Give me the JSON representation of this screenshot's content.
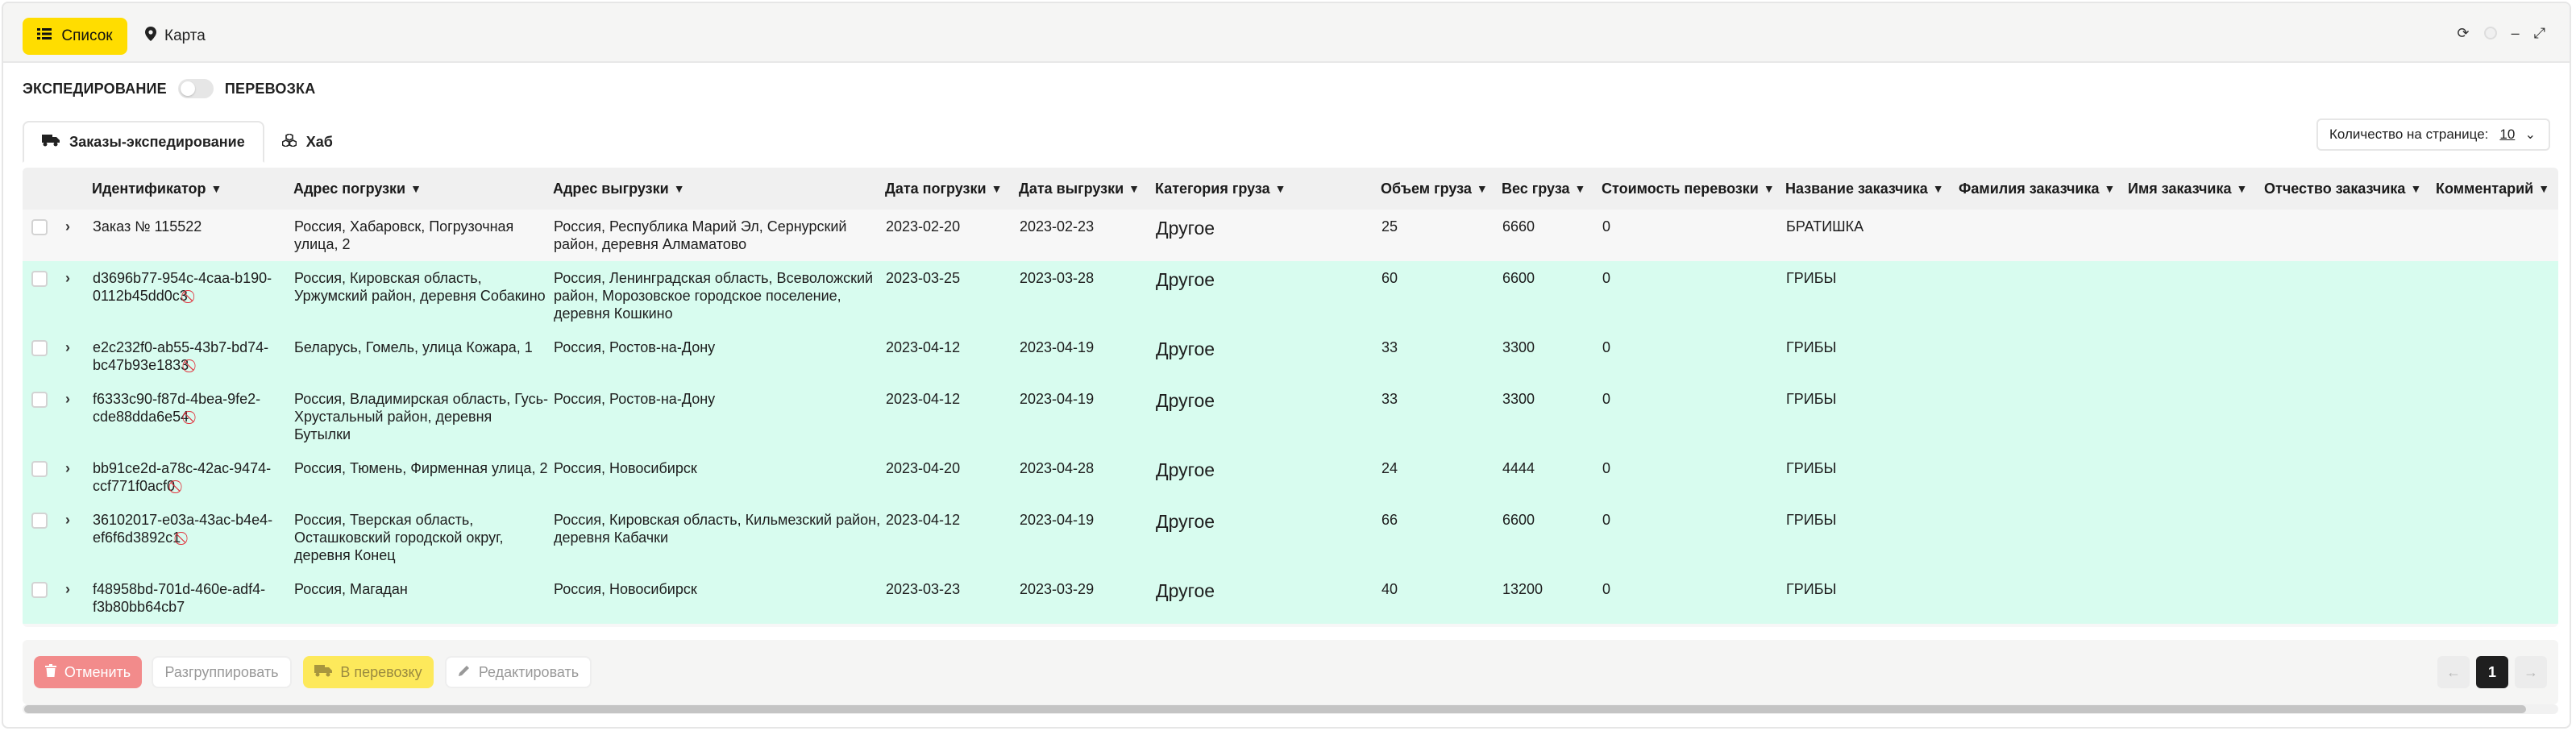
{
  "toolbar": {
    "list_label": "Список",
    "map_label": "Карта"
  },
  "mode_toggle": {
    "left_label": "ЭКСПЕДИРОВАНИЕ",
    "right_label": "ПЕРЕВОЗКА"
  },
  "tabs": [
    {
      "label": "Заказы-экспедирование",
      "active": true
    },
    {
      "label": "Хаб",
      "active": false
    }
  ],
  "page_size": {
    "label": "Количество на странице:",
    "value": "10"
  },
  "columns": [
    "Идентификатор",
    "Адрес погрузки",
    "Адрес выгрузки",
    "Дата погрузки",
    "Дата выгрузки",
    "Категория груза",
    "Объем груза",
    "Вес груза",
    "Стоимость перевозки",
    "Название заказчика",
    "Фамилия заказчика",
    "Имя заказчика",
    "Отчество заказчика",
    "Комментарий"
  ],
  "rows": [
    {
      "id": "Заказ № 115522",
      "ban": false,
      "load": "Россия, Хабаровск, Погрузочная улица, 2",
      "unload": "Россия, Республика Марий Эл, Сернурский район, деревня Алмаматово",
      "load_date": "2023-02-20",
      "unload_date": "2023-02-23",
      "category": "Другое",
      "volume": "25",
      "weight": "6660",
      "cost": "0",
      "customer": "БРАТИШКА"
    },
    {
      "id": "d3696b77-954c-4caa-b190-0112b45dd0c3",
      "ban": true,
      "load": "Россия, Кировская область, Уржумский район, деревня Собакино",
      "unload": "Россия, Ленинградская область, Всеволожский район, Морозовское городское поселение, деревня Кошкино",
      "load_date": "2023-03-25",
      "unload_date": "2023-03-28",
      "category": "Другое",
      "volume": "60",
      "weight": "6600",
      "cost": "0",
      "customer": "ГРИБЫ"
    },
    {
      "id": "e2c232f0-ab55-43b7-bd74-bc47b93e1833",
      "ban": true,
      "load": "Беларусь, Гомель, улица Кожара, 1",
      "unload": "Россия, Ростов-на-Дону",
      "load_date": "2023-04-12",
      "unload_date": "2023-04-19",
      "category": "Другое",
      "volume": "33",
      "weight": "3300",
      "cost": "0",
      "customer": "ГРИБЫ"
    },
    {
      "id": "f6333c90-f87d-4bea-9fe2-cde88dda6e54",
      "ban": true,
      "load": "Россия, Владимирская область, Гусь-Хрустальный район, деревня Бутылки",
      "unload": "Россия, Ростов-на-Дону",
      "load_date": "2023-04-12",
      "unload_date": "2023-04-19",
      "category": "Другое",
      "volume": "33",
      "weight": "3300",
      "cost": "0",
      "customer": "ГРИБЫ"
    },
    {
      "id": "bb91ce2d-a78c-42ac-9474-ccf771f0acf0",
      "ban": true,
      "load": "Россия, Тюмень, Фирменная улица, 2",
      "unload": "Россия, Новосибирск",
      "load_date": "2023-04-20",
      "unload_date": "2023-04-28",
      "category": "Другое",
      "volume": "24",
      "weight": "4444",
      "cost": "0",
      "customer": "ГРИБЫ"
    },
    {
      "id": "36102017-e03a-43ac-b4e4-ef6f6d3892c1",
      "ban": true,
      "load": "Россия, Тверская область, Осташковский городской округ, деревня Конец",
      "unload": "Россия, Кировская область, Кильмезский район, деревня Кабачки",
      "load_date": "2023-04-12",
      "unload_date": "2023-04-19",
      "category": "Другое",
      "volume": "66",
      "weight": "6600",
      "cost": "0",
      "customer": "ГРИБЫ"
    },
    {
      "id": "f48958bd-701d-460e-adf4-f3b80bb64cb7",
      "ban": false,
      "load": "Россия, Магадан",
      "unload": "Россия, Новосибирск",
      "load_date": "2023-03-23",
      "unload_date": "2023-03-29",
      "category": "Другое",
      "volume": "40",
      "weight": "13200",
      "cost": "0",
      "customer": "ГРИБЫ"
    }
  ],
  "actions": {
    "cancel": "Отменить",
    "ungroup": "Разгруппировать",
    "to_transport": "В перевозку",
    "edit": "Редактировать"
  },
  "pagination": {
    "current": "1",
    "prev_icon": "arrow-left-icon",
    "next_icon": "arrow-right-icon"
  },
  "colors": {
    "accent_yellow": "#ffdd00",
    "row_green": "#d8fcef",
    "cancel_red": "#f28b8b",
    "ban_red": "#e0303a"
  }
}
